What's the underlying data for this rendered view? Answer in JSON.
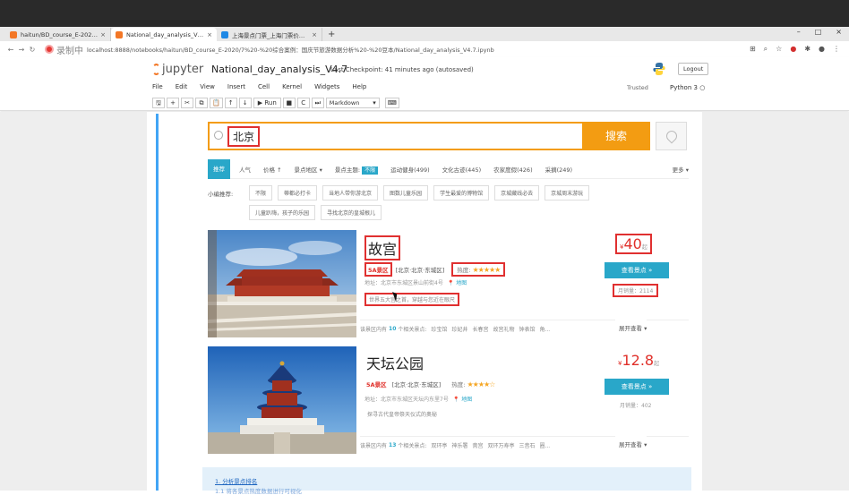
{
  "browser": {
    "tabs": [
      {
        "label": "haitun/BD_course_E-2020/7",
        "close": "×",
        "color": "#f37726"
      },
      {
        "label": "National_day_analysis_V4.7 -",
        "close": "×",
        "color": "#f37726"
      },
      {
        "label": "上海景点门票_上海门票价格_上海",
        "close": "×",
        "color": "#1e88e5"
      }
    ],
    "new_tab": "+",
    "window_controls": [
      "–",
      "□",
      "×"
    ],
    "recording_label": "录制中",
    "url": "localhost:8888/notebooks/haitun/BD_course_E-2020/7%20-%20综合案例：国庆节旅游数据分析%20-%20豆本/National_day_analysis_V4.7.ipynb"
  },
  "jupyter": {
    "logo_text": "jupyter",
    "notebook_title": "National_day_analysis_V4.7",
    "checkpoint": "Last Checkpoint: 41 minutes ago",
    "autosaved": "(autosaved)",
    "logout": "Logout",
    "menu": [
      "File",
      "Edit",
      "View",
      "Insert",
      "Cell",
      "Kernel",
      "Widgets",
      "Help"
    ],
    "trusted": "Trusted",
    "kernel": "Python 3",
    "toolbar": {
      "save": "🖫",
      "add": "+",
      "cut": "✂",
      "copy": "⧉",
      "paste": "📋",
      "up": "↑",
      "down": "↓",
      "run": "▶ Run",
      "stop": "■",
      "restart": "C",
      "fast": "⏭",
      "cell_type": "Markdown",
      "keyboard": "⌨"
    }
  },
  "web": {
    "search": {
      "value": "北京",
      "button": "搜索"
    },
    "sortbar": {
      "items": [
        "推荐",
        "人气",
        "价格 ↑",
        "景点地区 ▾"
      ],
      "theme_label": "景点主题:",
      "theme_badge": "不限",
      "themes": [
        "运动健身(499)",
        "文化古迹(445)",
        "农家度假(426)",
        "采摘(249)"
      ],
      "more": "更多 ▾"
    },
    "tags_header": "小编推荐:",
    "tags": [
      [
        "不限",
        "蒂都必打卡",
        "当地人带你游北京",
        "图数儿童乐园",
        "学生最爱的博物馆",
        "京城藏线必去",
        "京城周末游玩"
      ],
      [
        "儿童趴嗨，孩子的乐园",
        "寻找北京的皇城根儿"
      ]
    ],
    "spots": [
      {
        "name": "故宫",
        "level": "5A景区",
        "area": "[北京·北京·东城区]",
        "heat_label": "热度:",
        "stars": "★★★★★",
        "address": "地址：北京市东城区景山前街4号",
        "map": "📍 地图",
        "intro": "世界五大宫之首，穿越与您近在眼尺",
        "price_cur": "¥",
        "price": "40",
        "price_unit": "起",
        "view": "查看景点 »",
        "sold": "月销量：2114",
        "related_pre": "该景区内有",
        "related_count": "10",
        "related_post": "个相关景点:",
        "related_spots": [
          "珍宝馆",
          "珍妃井",
          "长春宫",
          "故宫礼物",
          "钟表馆",
          "角..."
        ],
        "expand": "展开查看 ▾"
      },
      {
        "name": "天坛公园",
        "level": "5A景区",
        "area": "[北京·北京·东城区]",
        "heat_label": "热度:",
        "stars": "★★★★☆",
        "address": "地址：北京市东城区天坛内东里7号",
        "map": "📍 地图",
        "intro": "探寻古代皇帝祭天仪式的奥秘",
        "price_cur": "¥",
        "price": "12.8",
        "price_unit": "起",
        "view": "查看景点 »",
        "sold": "月销量：402",
        "related_pre": "该景区内有",
        "related_count": "13",
        "related_post": "个相关景点:",
        "related_spots": [
          "双环亭",
          "神乐署",
          "斋宫",
          "双环万寿亭",
          "三音石",
          "圈..."
        ],
        "expand": "展开查看 ▾"
      }
    ]
  },
  "markdown_cell": {
    "toc_1": "1. 分析景点排名",
    "toc_2": "1.1 将各景点热度数据进行可视化"
  }
}
